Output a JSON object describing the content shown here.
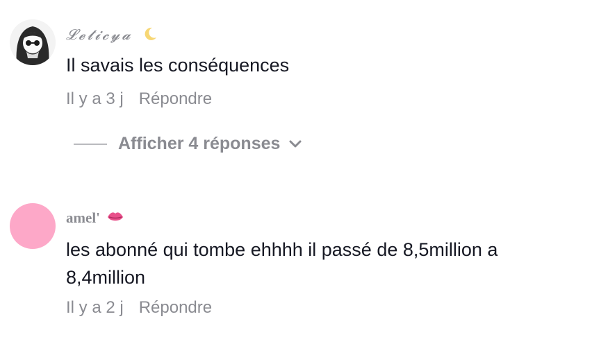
{
  "comments": [
    {
      "username": "𝓛𝓮𝓽𝓲𝓬𝔂𝓪",
      "username_emoji": "crescent-moon-icon",
      "text": "Il savais les conséquences",
      "time": "Il y a 3 j",
      "reply_label": "Répondre",
      "view_replies_label": "Afficher 4 réponses"
    },
    {
      "username": "amel'",
      "username_emoji": "lips-icon",
      "text": "les abonné qui tombe ehhhh il passé de 8,5million a 8,4million",
      "time": "Il y a 2 j",
      "reply_label": "Répondre"
    }
  ],
  "colors": {
    "text": "#161823",
    "muted": "#8a8b91",
    "avatar_pink": "#fda8c8"
  }
}
